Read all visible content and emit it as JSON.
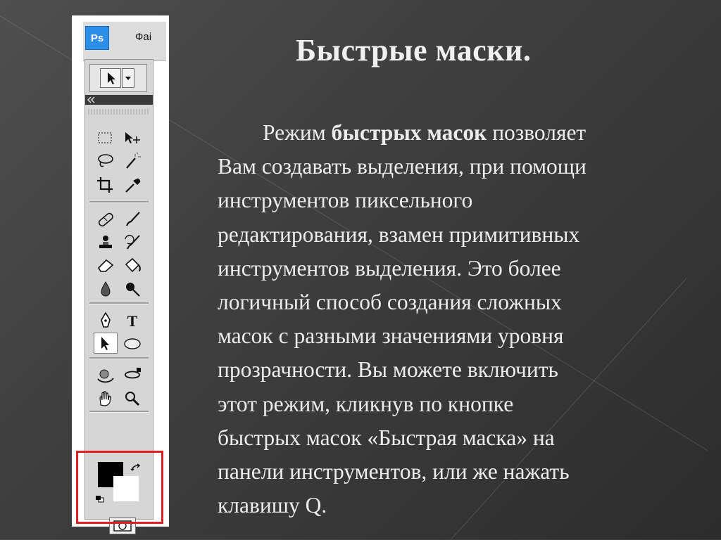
{
  "slide": {
    "title": "Быстрые маски.",
    "paragraph": {
      "line1": {
        "pre": "Режим ",
        "bold": "быстрых масок",
        "post": " позволяет"
      },
      "lines": [
        "Вам создавать выделения, при помощи",
        "инструментов пиксельного",
        "редактирования, взамен примитивных",
        "инструментов выделения. Это более",
        "логичный способ создания сложных",
        "масок с разными значениями уровня",
        "прозрачности. Вы можете включить",
        "этот режим, кликнув по кнопке",
        "быстрых масок «Быстрая маска» на",
        "панели инструментов, или же нажать",
        "клавишу Q."
      ]
    }
  },
  "photoshop": {
    "logo": "Ps",
    "menu_item": "Фаі",
    "highlight_color": "#e02020",
    "tools": [
      {
        "name": "rectangular-marquee-icon"
      },
      {
        "name": "move-icon"
      },
      {
        "name": "lasso-icon"
      },
      {
        "name": "magic-wand-icon"
      },
      {
        "name": "crop-icon"
      },
      {
        "name": "eyedropper-icon"
      },
      {
        "name": "healing-brush-icon"
      },
      {
        "name": "brush-icon"
      },
      {
        "name": "clone-stamp-icon"
      },
      {
        "name": "history-brush-icon"
      },
      {
        "name": "eraser-icon"
      },
      {
        "name": "paint-bucket-icon"
      },
      {
        "name": "blur-icon"
      },
      {
        "name": "dodge-icon"
      },
      {
        "name": "pen-icon"
      },
      {
        "name": "type-icon",
        "glyph": "T"
      },
      {
        "name": "path-selection-icon"
      },
      {
        "name": "ellipse-icon"
      },
      {
        "name": "3d-rotate-icon"
      },
      {
        "name": "3d-orbit-icon"
      },
      {
        "name": "hand-icon"
      },
      {
        "name": "zoom-icon"
      }
    ]
  }
}
